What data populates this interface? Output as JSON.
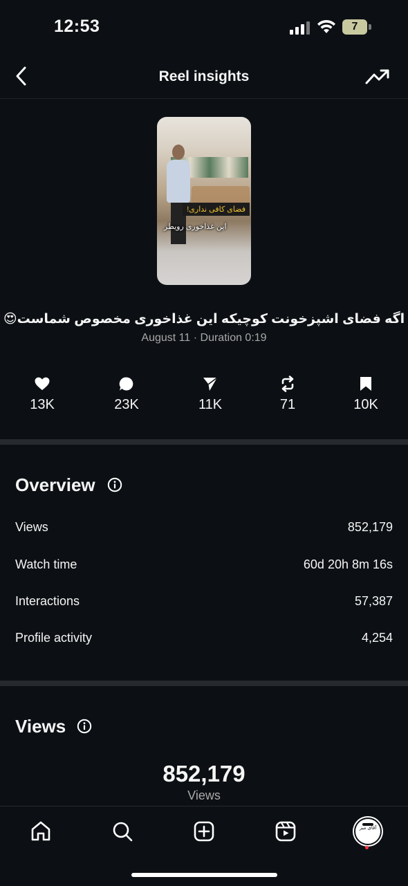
{
  "status_bar": {
    "time": "12:53",
    "battery": "7"
  },
  "header": {
    "title": "Reel insights"
  },
  "reel": {
    "thumbnail_text_1": "فضای کافی نداری!",
    "thumbnail_text_2": "این غذاخوری رویطر",
    "caption": "اگه فضای اشپزخونت کوچیکه این غذاخوری مخصوص شماست😍",
    "meta": "August 11 · Duration 0:19"
  },
  "stats": [
    {
      "icon": "heart-icon",
      "value": "13K"
    },
    {
      "icon": "comment-icon",
      "value": "23K"
    },
    {
      "icon": "share-icon",
      "value": "11K"
    },
    {
      "icon": "repost-icon",
      "value": "71"
    },
    {
      "icon": "bookmark-icon",
      "value": "10K"
    }
  ],
  "overview": {
    "title": "Overview",
    "rows": [
      {
        "label": "Views",
        "value": "852,179"
      },
      {
        "label": "Watch time",
        "value": "60d 20h 8m 16s"
      },
      {
        "label": "Interactions",
        "value": "57,387"
      },
      {
        "label": "Profile activity",
        "value": "4,254"
      }
    ]
  },
  "views_section": {
    "title": "Views",
    "total": "852,179",
    "label": "Views"
  },
  "tabbar": {
    "items": [
      "home-icon",
      "search-icon",
      "create-icon",
      "reels-icon",
      "profile-avatar"
    ],
    "avatar_text": "آقای میز"
  },
  "colors": {
    "background": "#0c1014",
    "text": "#f5f5f5",
    "secondary": "#a8a8a8",
    "divider": "#262a2e",
    "notification": "#ff3040"
  }
}
